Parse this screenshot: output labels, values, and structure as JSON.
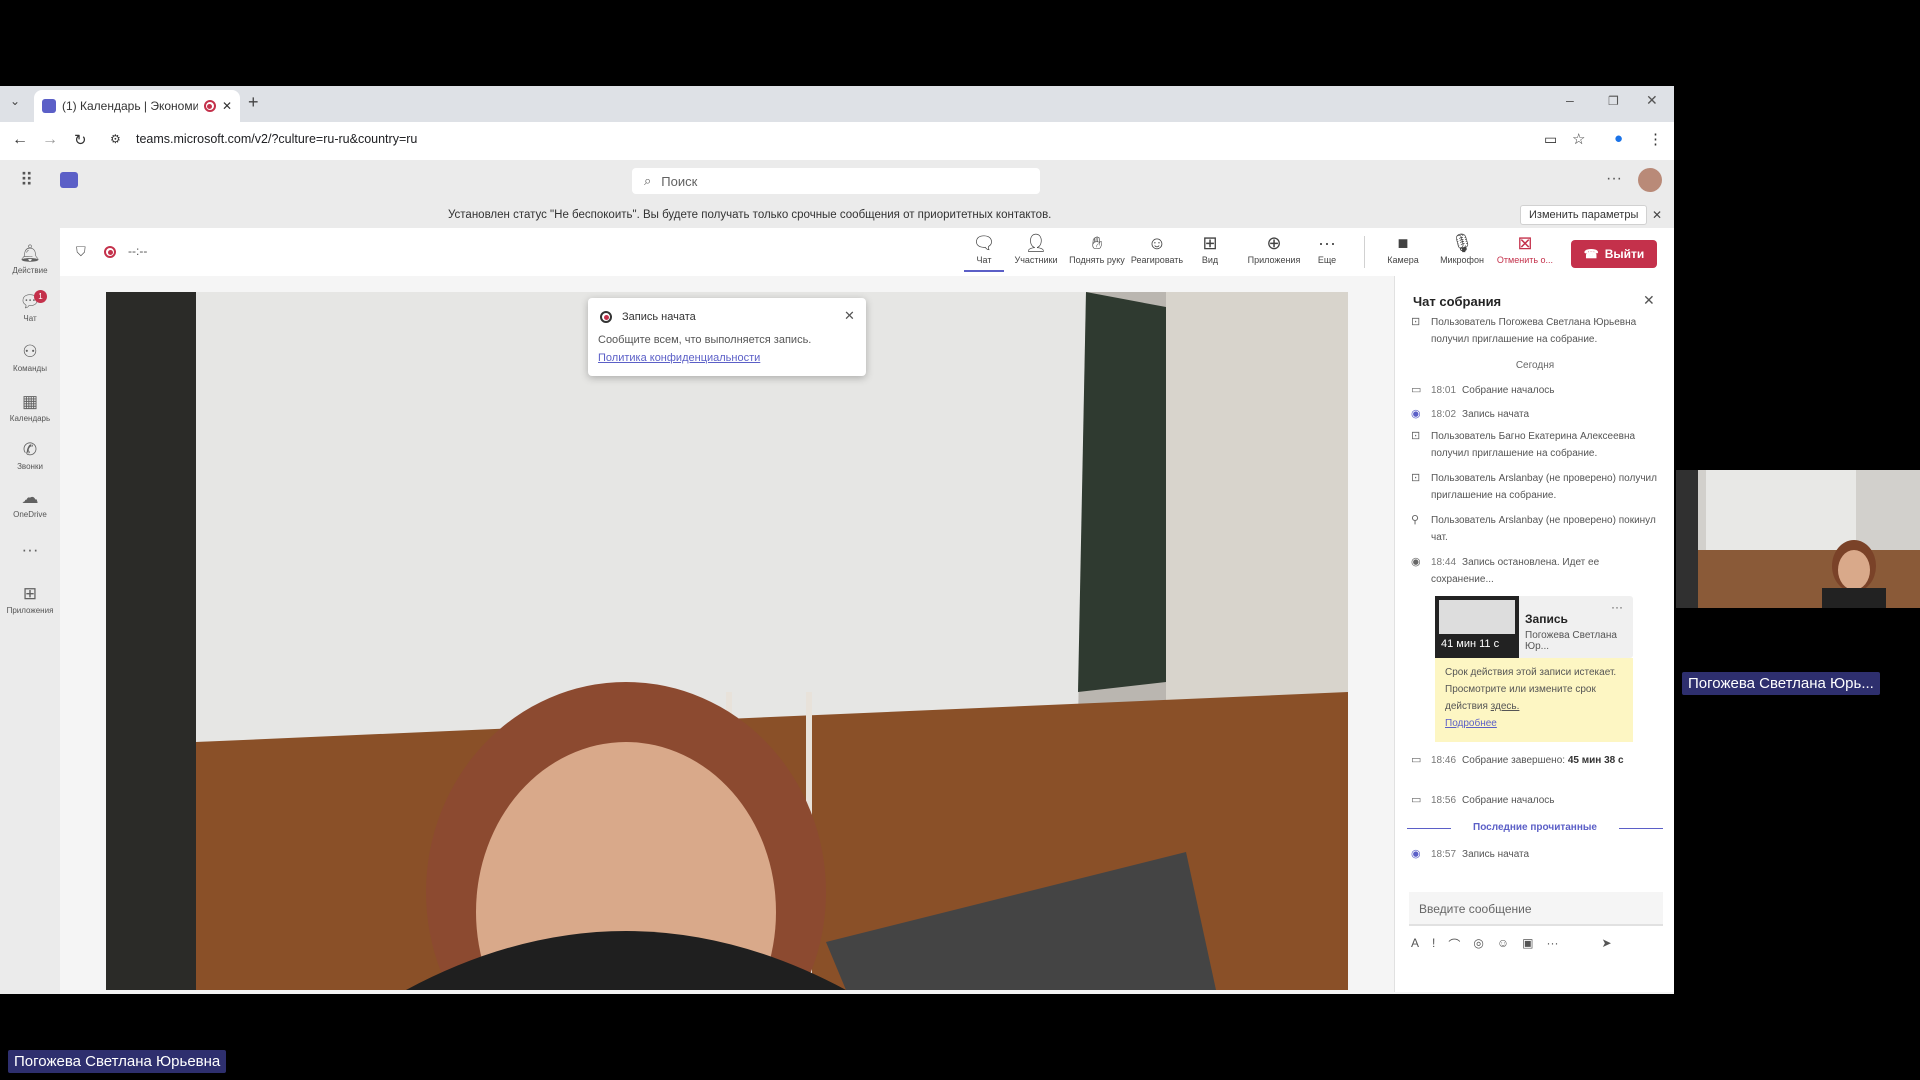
{
  "browser": {
    "tab_title": "(1) Календарь | Экономик...",
    "url": "teams.microsoft.com/v2/?culture=ru-ru&country=ru"
  },
  "teams": {
    "search_placeholder": "Поиск",
    "notice_text": "Установлен статус \"Не беспокоить\". Вы будете получать только срочные сообщения от приоритетных контактов.",
    "notice_button": "Изменить параметры"
  },
  "rail": [
    {
      "label": "Действие",
      "icon": "bell-icon"
    },
    {
      "label": "Чат",
      "icon": "chat-icon",
      "badge": "1"
    },
    {
      "label": "Команды",
      "icon": "teams-icon"
    },
    {
      "label": "Календарь",
      "icon": "calendar-icon"
    },
    {
      "label": "Звонки",
      "icon": "phone-icon"
    },
    {
      "label": "OneDrive",
      "icon": "cloud-icon"
    },
    {
      "label": "Приложения",
      "icon": "plus-icon"
    }
  ],
  "meeting": {
    "timer": "--:--",
    "toolbar": {
      "chat": "Чат",
      "participants": "Участники",
      "raise_hand": "Поднять руку",
      "react": "Реагировать",
      "view": "Вид",
      "apps": "Приложения",
      "more": "Еще",
      "camera": "Камера",
      "mic": "Микрофон",
      "cancel": "Отменить о...",
      "leave": "Выйти"
    }
  },
  "toast": {
    "title": "Запись начата",
    "text": "Сообщите всем, что выполняется запись.",
    "link": "Политика конфиденциальности"
  },
  "chat": {
    "title": "Чат собрания",
    "events": [
      {
        "time": "",
        "text": "Пользователь Погожева Светлана Юрьевна получил приглашение на собрание."
      },
      {
        "time": "18:01",
        "text": "Собрание началось"
      },
      {
        "time": "18:02",
        "text": "Запись начата"
      },
      {
        "time": "",
        "text": "Пользователь Багно Екатерина Алексеевна получил приглашение на собрание."
      },
      {
        "time": "",
        "text": "Пользователь Arslanbay (не проверено) получил приглашение на собрание."
      },
      {
        "time": "",
        "text": "Пользователь Arslanbay (не проверено) покинул чат."
      },
      {
        "time": "18:44",
        "text": "Запись остановлена. Идет ее сохранение..."
      },
      {
        "time": "18:46",
        "text": "Собрание завершено:",
        "bold": "45 мин 38 с"
      },
      {
        "time": "18:56",
        "text": "Собрание началось"
      },
      {
        "time": "18:57",
        "text": "Запись начата"
      }
    ],
    "today": "Сегодня",
    "last_read": "Последние прочитанные",
    "recording_card": {
      "title": "Запись",
      "owner": "Погожева Светлана Юр...",
      "duration": "41 мин 11 с",
      "expiry_text": "Срок действия этой записи истекает. Просмотрите или измените срок действия",
      "expiry_link": "здесь.",
      "more_link": "Подробнее"
    },
    "input_placeholder": "Введите сообщение"
  },
  "participants": {
    "main_name": "Погожева Светлана Юрьевна",
    "self_name": "Погожева Светлана Юрь..."
  }
}
